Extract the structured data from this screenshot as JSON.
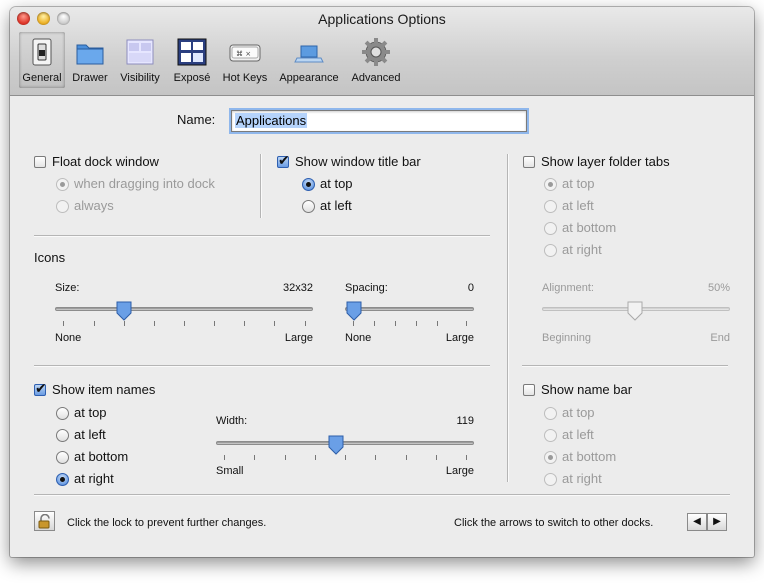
{
  "window": {
    "title": "Applications Options"
  },
  "toolbar": {
    "items": [
      {
        "label": "General",
        "icon": "general-switch-icon"
      },
      {
        "label": "Drawer",
        "icon": "drawer-folder-icon"
      },
      {
        "label": "Visibility",
        "icon": "visibility-window-icon"
      },
      {
        "label": "Exposé",
        "icon": "expose-windows-icon"
      },
      {
        "label": "Hot Keys",
        "icon": "keyboard-key-icon"
      },
      {
        "label": "Appearance",
        "icon": "appearance-dock-icon"
      },
      {
        "label": "Advanced",
        "icon": "gear-icon"
      }
    ]
  },
  "name": {
    "label": "Name:",
    "value": "Applications"
  },
  "float": {
    "label": "Float dock window",
    "checked": false,
    "options": [
      "when dragging into dock",
      "always"
    ],
    "selected": 0
  },
  "title_bar": {
    "label": "Show window title bar",
    "checked": true,
    "options": [
      "at top",
      "at left"
    ],
    "selected": 0
  },
  "layer_tabs": {
    "label": "Show layer folder tabs",
    "checked": false,
    "options": [
      "at top",
      "at left",
      "at bottom",
      "at right"
    ],
    "selected": 0,
    "alignment": {
      "label": "Alignment:",
      "value": "50%",
      "min_label": "Beginning",
      "max_label": "End",
      "level": 0.5
    }
  },
  "icons": {
    "heading": "Icons",
    "size": {
      "label": "Size:",
      "value": "32x32",
      "min_label": "None",
      "max_label": "Large",
      "level": 0.27
    },
    "spacing": {
      "label": "Spacing:",
      "value": "0",
      "min_label": "None",
      "max_label": "Large",
      "level": 0.0
    }
  },
  "item_names": {
    "label": "Show item names",
    "checked": true,
    "options": [
      "at top",
      "at left",
      "at bottom",
      "at right"
    ],
    "selected": 3,
    "width": {
      "label": "Width:",
      "value": "119",
      "min_label": "Small",
      "max_label": "Large",
      "level": 0.47
    }
  },
  "name_bar": {
    "label": "Show name bar",
    "checked": false,
    "options": [
      "at top",
      "at left",
      "at bottom",
      "at right"
    ],
    "selected": 2
  },
  "footer": {
    "lock_text": "Click the lock to prevent further changes.",
    "arrows_text": "Click the arrows to switch to other docks.",
    "prev_arrow": "◀",
    "next_arrow": "▶"
  },
  "colors": {
    "accent": "#3d6fc2",
    "selection": "#b5d3fb",
    "window_bg": "#ececec"
  }
}
